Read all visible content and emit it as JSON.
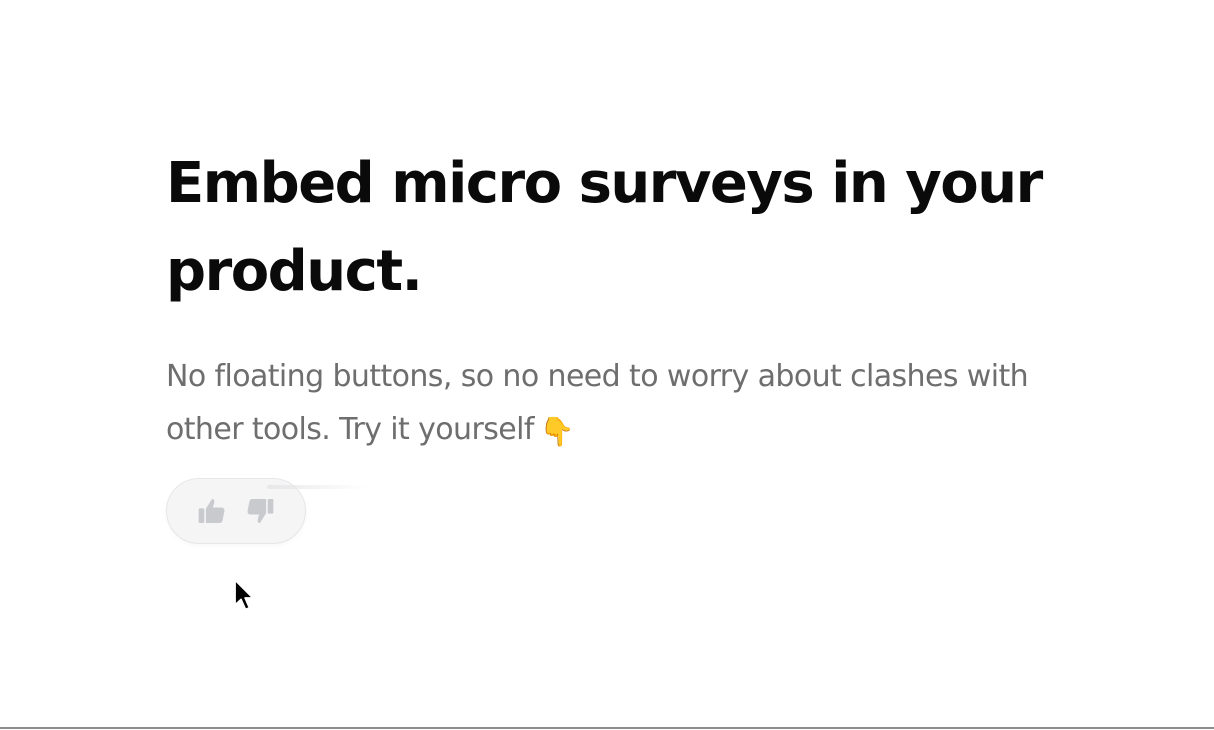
{
  "hero": {
    "headline": "Embed micro surveys in your product.",
    "subtext": "No floating buttons, so no need to worry about clashes with other tools. Try it yourself",
    "subtext_emoji": "👇"
  },
  "survey_widget": {
    "upvote_icon": "thumbs-up-icon",
    "downvote_icon": "thumbs-down-icon"
  },
  "colors": {
    "heading": "#0a0a0a",
    "body_text": "#6e6e6e",
    "widget_bg": "#f5f5f6",
    "icon": "#c9cacd"
  }
}
